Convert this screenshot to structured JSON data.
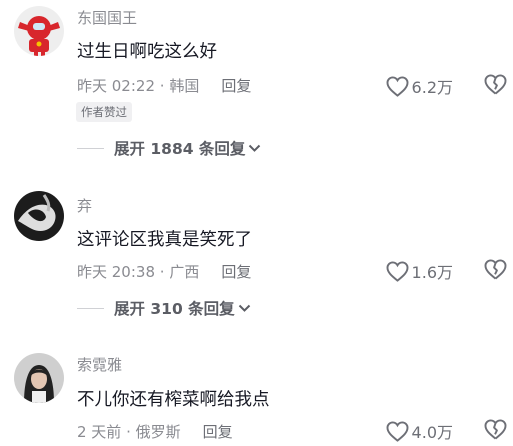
{
  "comments": [
    {
      "username": "东国国王",
      "text": "过生日啊吃这么好",
      "time": "昨天 02:22",
      "location": "韩国",
      "reply_label": "回复",
      "likes": "6.2万",
      "badge": "作者赞过",
      "expand_label": "展开 1884 条回复",
      "avatar_icon": "red-robot-avatar"
    },
    {
      "username": "弃",
      "text": "这评论区我真是笑死了",
      "time": "昨天 20:38",
      "location": "广西",
      "reply_label": "回复",
      "likes": "1.6万",
      "expand_label": "展开 310 条回复",
      "avatar_icon": "bw-abstract-avatar"
    },
    {
      "username": "索霓雅",
      "text": "不儿你还有榨菜啊给我点",
      "time": "2 天前",
      "location": "俄罗斯",
      "reply_label": "回复",
      "likes": "4.0万",
      "avatar_icon": "portrait-avatar"
    }
  ],
  "separator": " · ",
  "colors": {
    "text": "#161823",
    "meta": "#8a8b91",
    "badge_bg": "#f0f0f2"
  }
}
